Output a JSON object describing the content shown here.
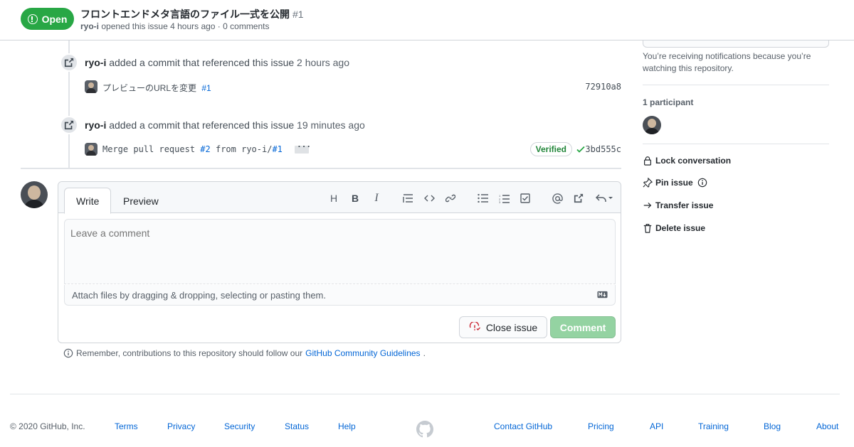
{
  "header": {
    "state": "Open",
    "title": "フロントエンドメタ言語のファイル一式を公開",
    "number": "#1",
    "author": "ryo-i",
    "meta": "opened this issue 4 hours ago · 0 comments"
  },
  "timeline": [
    {
      "author": "ryo-i",
      "action": "added a commit that referenced this issue",
      "time": "2 hours ago",
      "commit": {
        "message": "プレビューのURLを変更",
        "ref": "#1",
        "sha": "72910a8"
      }
    },
    {
      "author": "ryo-i",
      "action": "added a commit that referenced this issue",
      "time": "19 minutes ago",
      "commit": {
        "message_prefix": "Merge pull request",
        "pr_ref": "#2",
        "message_mid": "from ryo-i/",
        "ref": "#1",
        "verified": "Verified",
        "sha": "3bd555c"
      }
    }
  ],
  "comment_form": {
    "tab_write": "Write",
    "tab_preview": "Preview",
    "placeholder": "Leave a comment",
    "attach_hint": "Attach files by dragging & dropping, selecting or pasting them.",
    "close_label": "Close issue",
    "comment_label": "Comment",
    "guidelines_prefix": "Remember, contributions to this repository should follow our",
    "guidelines_link": "GitHub Community Guidelines",
    "guidelines_suffix": "."
  },
  "sidebar": {
    "notice": "You’re receiving notifications because you’re watching this repository.",
    "participants_heading": "1 participant",
    "actions": {
      "lock": "Lock conversation",
      "pin": "Pin issue",
      "transfer": "Transfer issue",
      "delete": "Delete issue"
    }
  },
  "footer": {
    "copyright": "© 2020 GitHub, Inc.",
    "links_left": [
      "Terms",
      "Privacy",
      "Security",
      "Status",
      "Help"
    ],
    "links_right": [
      "Contact GitHub",
      "Pricing",
      "API",
      "Training",
      "Blog",
      "About"
    ]
  },
  "colors": {
    "open_green": "#28a745",
    "link_blue": "#0366d6",
    "comment_disabled": "#94d3a2",
    "close_red": "#cb2431"
  }
}
